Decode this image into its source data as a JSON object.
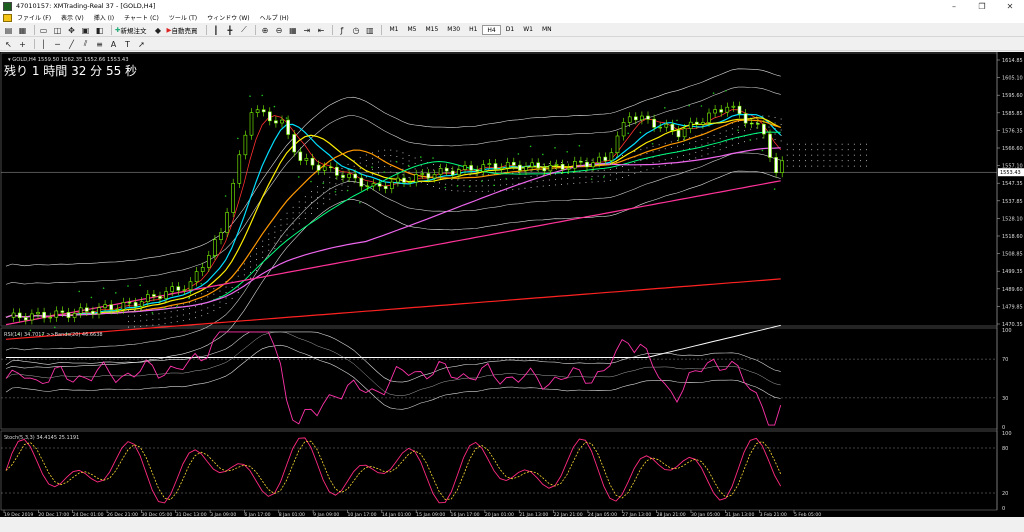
{
  "window": {
    "title": "47010157: XMTrading-Real 37 - [GOLD,H4]"
  },
  "menu": [
    "ファイル (F)",
    "表示 (V)",
    "挿入 (I)",
    "チャート (C)",
    "ツール (T)",
    "ウィンドウ (W)",
    "ヘルプ (H)"
  ],
  "toolbar": {
    "new_order": "新規注文",
    "auto_trade": "自動売買",
    "timeframes": [
      "M1",
      "M5",
      "M15",
      "M30",
      "H1",
      "H4",
      "D1",
      "W1",
      "MN"
    ],
    "active_timeframe": "H4"
  },
  "chart": {
    "header": "GOLD,H4 1559.50 1562.35 1552.66 1553.43",
    "countdown": "残り 1 時間 32 分 55 秒",
    "current_price": "1553.43",
    "price_ticks": [
      "1614.85",
      "1605.10",
      "1595.60",
      "1585.85",
      "1576.35",
      "1566.60",
      "1557.10",
      "1547.35",
      "1537.85",
      "1528.10",
      "1518.60",
      "1508.85",
      "1499.35",
      "1489.60",
      "1479.85",
      "1470.35"
    ],
    "rsi_header": "RSI(14) 34.7017  >>Bands(20) 46.6638",
    "rsi_levels": [
      "100",
      "70",
      "30",
      "0"
    ],
    "stoch_header": "Stoch(5,3,3) 34.4145 25.1191",
    "stoch_levels": [
      "100",
      "80",
      "20",
      "0"
    ],
    "time_ticks": [
      "19 Dec 2019",
      "20 Dec 17:00",
      "24 Dec 01:00",
      "26 Dec 21:00",
      "30 Dec 05:00",
      "31 Dec 13:00",
      "3 Jan 09:00",
      "6 Jan 17:00",
      "8 Jan 01:00",
      "9 Jan 09:00",
      "10 Jan 17:00",
      "14 Jan 01:00",
      "15 Jan 09:00",
      "16 Jan 17:00",
      "20 Jan 01:00",
      "21 Jan 13:00",
      "22 Jan 21:00",
      "24 Jan 05:00",
      "27 Jan 13:00",
      "28 Jan 21:00",
      "30 Jan 05:00",
      "31 Jan 13:00",
      "3 Feb 21:00",
      "5 Feb 05:00"
    ]
  },
  "colors": {
    "background": "#000000",
    "candle": "#7CFC00",
    "grid": "#555555"
  }
}
